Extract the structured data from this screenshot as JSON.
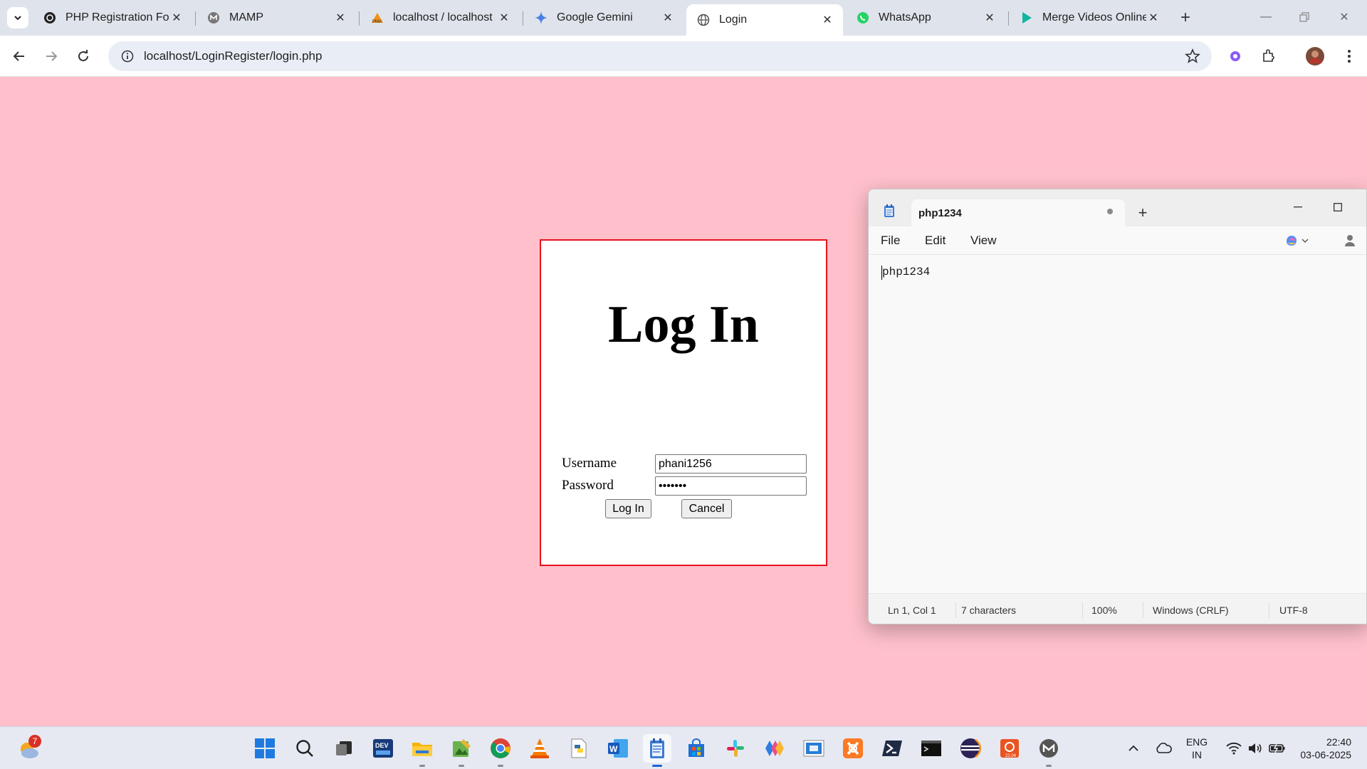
{
  "browser": {
    "tabs": [
      {
        "title": "PHP Registration Form",
        "icon": "openai-icon"
      },
      {
        "title": "MAMP",
        "icon": "mamp-icon"
      },
      {
        "title": "localhost / localhost",
        "icon": "phpmyadmin-icon"
      },
      {
        "title": "Google Gemini",
        "icon": "gemini-icon"
      },
      {
        "title": "Login",
        "icon": "globe-icon",
        "active": true
      },
      {
        "title": "WhatsApp",
        "icon": "whatsapp-icon"
      },
      {
        "title": "Merge Videos Online",
        "icon": "play-icon"
      }
    ],
    "url": "localhost/LoginRegister/login.php"
  },
  "login": {
    "title": "Log In",
    "username_label": "Username",
    "username_value": "phani1256",
    "password_label": "Password",
    "password_value": "•••••••",
    "login_button": "Log In",
    "cancel_button": "Cancel"
  },
  "notepad": {
    "tab_title": "php1234",
    "menu": [
      "File",
      "Edit",
      "View"
    ],
    "content": "php1234",
    "status": {
      "position": "Ln 1, Col 1",
      "characters": "7 characters",
      "zoom": "100%",
      "line_ending": "Windows (CRLF)",
      "encoding": "UTF-8"
    }
  },
  "taskbar": {
    "weather_badge": "7",
    "language_line1": "ENG",
    "language_line2": "IN",
    "time": "22:40",
    "date": "03-06-2025"
  },
  "colors": {
    "page_background": "#ffc0cb",
    "login_border": "#e8121c",
    "accent": "#1a62d6"
  }
}
